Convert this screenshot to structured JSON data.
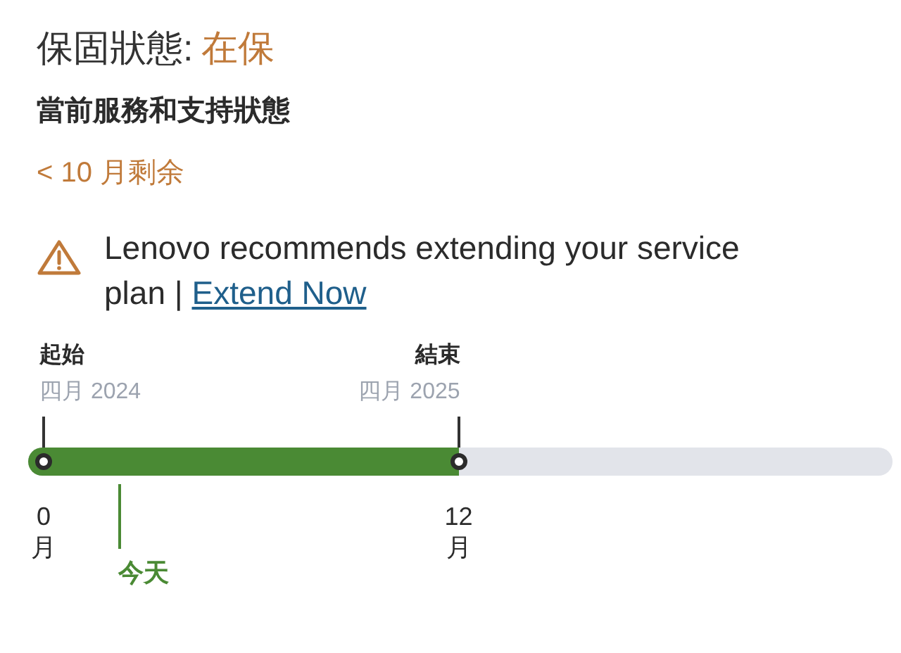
{
  "warranty": {
    "label": "保固狀態:",
    "status": "在保"
  },
  "section_title": "當前服務和支持狀態",
  "remaining": "< 10 月剩余",
  "notice": {
    "text": "Lenovo recommends extending your service plan |",
    "link": "Extend Now"
  },
  "timeline": {
    "start": {
      "label": "起始",
      "date": "四月 2024"
    },
    "end": {
      "label": "結束",
      "date": "四月 2025"
    },
    "level": 0.498,
    "ticks": [
      {
        "number": "0",
        "unit": "月"
      },
      {
        "number": "12",
        "unit": "月"
      }
    ],
    "today": {
      "label": "今天"
    }
  }
}
